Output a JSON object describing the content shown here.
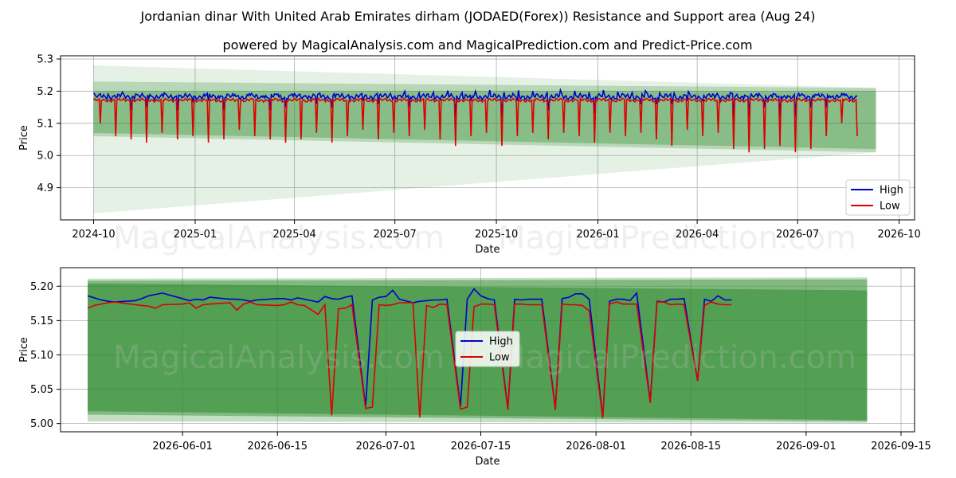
{
  "titles": {
    "line1": "Jordanian dinar With United Arab Emirates dirham (JODAED(Forex)) Resistance and Support area (Aug 24)",
    "line2": "powered by MagicalAnalysis.com and MagicalPrediction.com and Predict-Price.com"
  },
  "watermarks": [
    "MagicalAnalysis.com",
    "MagicalPrediction.com"
  ],
  "colors": {
    "high": "#0000cc",
    "low": "#dd0000",
    "band": "#2e8b2e",
    "grid": "#b0b0b0"
  },
  "chart_data": [
    {
      "type": "line",
      "panel": "overview",
      "xlabel": "Date",
      "ylabel": "Price",
      "x_range": [
        "2024-09-01",
        "2026-10-15"
      ],
      "ylim": [
        4.8,
        5.31
      ],
      "xticks": [
        "2024-10",
        "2025-01",
        "2025-04",
        "2025-07",
        "2025-10",
        "2026-01",
        "2026-04",
        "2026-07",
        "2026-10"
      ],
      "yticks": [
        "4.9",
        "5.0",
        "5.1",
        "5.2",
        "5.3"
      ],
      "grid": true,
      "legend": {
        "placement": "lower-right",
        "entries": [
          "High",
          "Low"
        ]
      },
      "x_start": "2024-10-01",
      "x_end": "2026-08-24",
      "high_base": 5.183,
      "low_base": 5.172,
      "low_dips": [
        5.1,
        5.06,
        5.05,
        5.04,
        5.07,
        5.05,
        5.06,
        5.04,
        5.05,
        5.08,
        5.06,
        5.05,
        5.04,
        5.05,
        5.07,
        5.04,
        5.06,
        5.08,
        5.05,
        5.07,
        5.06,
        5.08,
        5.05,
        5.03,
        5.06,
        5.07,
        5.03,
        5.06,
        5.07,
        5.05,
        5.07,
        5.06,
        5.04,
        5.07,
        5.06,
        5.07,
        5.05,
        5.03,
        5.08,
        5.06,
        5.07,
        5.02,
        5.01,
        5.02,
        5.03,
        5.01,
        5.02,
        5.06
      ],
      "bands": [
        {
          "x": [
            "2024-10-01",
            "2026-09-10"
          ],
          "upper": [
            5.28,
            5.21
          ],
          "lower": [
            4.82,
            5.01
          ],
          "opacity": 0.12
        },
        {
          "x": [
            "2024-10-01",
            "2026-09-10"
          ],
          "upper": [
            5.23,
            5.21
          ],
          "lower": [
            5.06,
            5.01
          ],
          "opacity": 0.25
        },
        {
          "x": [
            "2024-10-01",
            "2026-09-10"
          ],
          "upper": [
            5.2,
            5.2
          ],
          "lower": [
            5.07,
            5.02
          ],
          "opacity": 0.35
        }
      ]
    },
    {
      "type": "line",
      "panel": "zoom",
      "xlabel": "Date",
      "ylabel": "Price",
      "x_range": [
        "2026-05-14",
        "2026-09-17"
      ],
      "ylim": [
        4.988,
        5.227
      ],
      "xticks": [
        "2026-06-01",
        "2026-06-15",
        "2026-07-01",
        "2026-07-15",
        "2026-08-01",
        "2026-08-15",
        "2026-09-01",
        "2026-09-15"
      ],
      "yticks": [
        "5.00",
        "5.05",
        "5.10",
        "5.15",
        "5.20"
      ],
      "grid": true,
      "legend": {
        "placement": "center",
        "entries": [
          "High",
          "Low"
        ]
      },
      "x": [
        "2026-05-18",
        "2026-05-19",
        "2026-05-20",
        "2026-05-21",
        "2026-05-22",
        "2026-05-25",
        "2026-05-26",
        "2026-05-27",
        "2026-05-28",
        "2026-05-29",
        "2026-06-01",
        "2026-06-02",
        "2026-06-03",
        "2026-06-04",
        "2026-06-05",
        "2026-06-08",
        "2026-06-09",
        "2026-06-10",
        "2026-06-11",
        "2026-06-12",
        "2026-06-15",
        "2026-06-16",
        "2026-06-17",
        "2026-06-18",
        "2026-06-19",
        "2026-06-21",
        "2026-06-22",
        "2026-06-23",
        "2026-06-24",
        "2026-06-25",
        "2026-06-26",
        "2026-06-28",
        "2026-06-29",
        "2026-06-30",
        "2026-07-01",
        "2026-07-02",
        "2026-07-03",
        "2026-07-05",
        "2026-07-06",
        "2026-07-07",
        "2026-07-08",
        "2026-07-09",
        "2026-07-10",
        "2026-07-12",
        "2026-07-13",
        "2026-07-14",
        "2026-07-15",
        "2026-07-16",
        "2026-07-17",
        "2026-07-19",
        "2026-07-20",
        "2026-07-21",
        "2026-07-22",
        "2026-07-23",
        "2026-07-24",
        "2026-07-26",
        "2026-07-27",
        "2026-07-28",
        "2026-07-29",
        "2026-07-30",
        "2026-07-31",
        "2026-08-02",
        "2026-08-03",
        "2026-08-04",
        "2026-08-05",
        "2026-08-06",
        "2026-08-07",
        "2026-08-09",
        "2026-08-10",
        "2026-08-11",
        "2026-08-12",
        "2026-08-13",
        "2026-08-14",
        "2026-08-16",
        "2026-08-17",
        "2026-08-18",
        "2026-08-19",
        "2026-08-20",
        "2026-08-21"
      ],
      "series": [
        {
          "name": "High",
          "values": [
            5.186,
            5.183,
            5.18,
            5.178,
            5.177,
            5.179,
            5.182,
            5.186,
            5.188,
            5.19,
            5.182,
            5.179,
            5.181,
            5.18,
            5.184,
            5.181,
            5.181,
            5.18,
            5.178,
            5.18,
            5.182,
            5.182,
            5.18,
            5.183,
            5.181,
            5.177,
            5.185,
            5.182,
            5.181,
            5.184,
            5.186,
            5.025,
            5.18,
            5.184,
            5.185,
            5.194,
            5.181,
            5.176,
            5.178,
            5.179,
            5.18,
            5.18,
            5.181,
            5.025,
            5.181,
            5.196,
            5.186,
            5.182,
            5.18,
            5.022,
            5.181,
            5.18,
            5.181,
            5.181,
            5.181,
            5.022,
            5.182,
            5.184,
            5.189,
            5.189,
            5.181,
            5.009,
            5.178,
            5.181,
            5.181,
            5.179,
            5.19,
            5.032,
            5.178,
            5.177,
            5.181,
            5.181,
            5.182,
            5.062,
            5.181,
            5.178,
            5.186,
            5.18,
            5.18
          ]
        },
        {
          "name": "Low",
          "values": [
            5.168,
            5.172,
            5.174,
            5.176,
            5.177,
            5.173,
            5.172,
            5.171,
            5.168,
            5.173,
            5.174,
            5.176,
            5.168,
            5.173,
            5.174,
            5.176,
            5.165,
            5.174,
            5.177,
            5.173,
            5.172,
            5.173,
            5.177,
            5.173,
            5.172,
            5.159,
            5.173,
            5.012,
            5.167,
            5.168,
            5.173,
            5.022,
            5.024,
            5.173,
            5.172,
            5.173,
            5.176,
            5.176,
            5.009,
            5.172,
            5.169,
            5.174,
            5.173,
            5.021,
            5.024,
            5.17,
            5.174,
            5.174,
            5.173,
            5.02,
            5.174,
            5.174,
            5.173,
            5.173,
            5.173,
            5.02,
            5.174,
            5.173,
            5.173,
            5.172,
            5.164,
            5.008,
            5.174,
            5.177,
            5.174,
            5.174,
            5.174,
            5.03,
            5.177,
            5.177,
            5.173,
            5.174,
            5.173,
            5.062,
            5.172,
            5.177,
            5.174,
            5.173,
            5.173
          ]
        }
      ],
      "bands": [
        {
          "x": [
            "2026-05-18",
            "2026-09-10"
          ],
          "upper": [
            5.211,
            5.213
          ],
          "lower": [
            5.003,
            5.001
          ],
          "opacity": 0.28
        },
        {
          "x": [
            "2026-05-18",
            "2026-09-10"
          ],
          "upper": [
            5.208,
            5.21
          ],
          "lower": [
            5.013,
            5.003
          ],
          "opacity": 0.45
        },
        {
          "x": [
            "2026-05-18",
            "2026-09-10"
          ],
          "upper": [
            5.204,
            5.194
          ],
          "lower": [
            5.018,
            5.005
          ],
          "opacity": 0.55
        }
      ]
    }
  ]
}
